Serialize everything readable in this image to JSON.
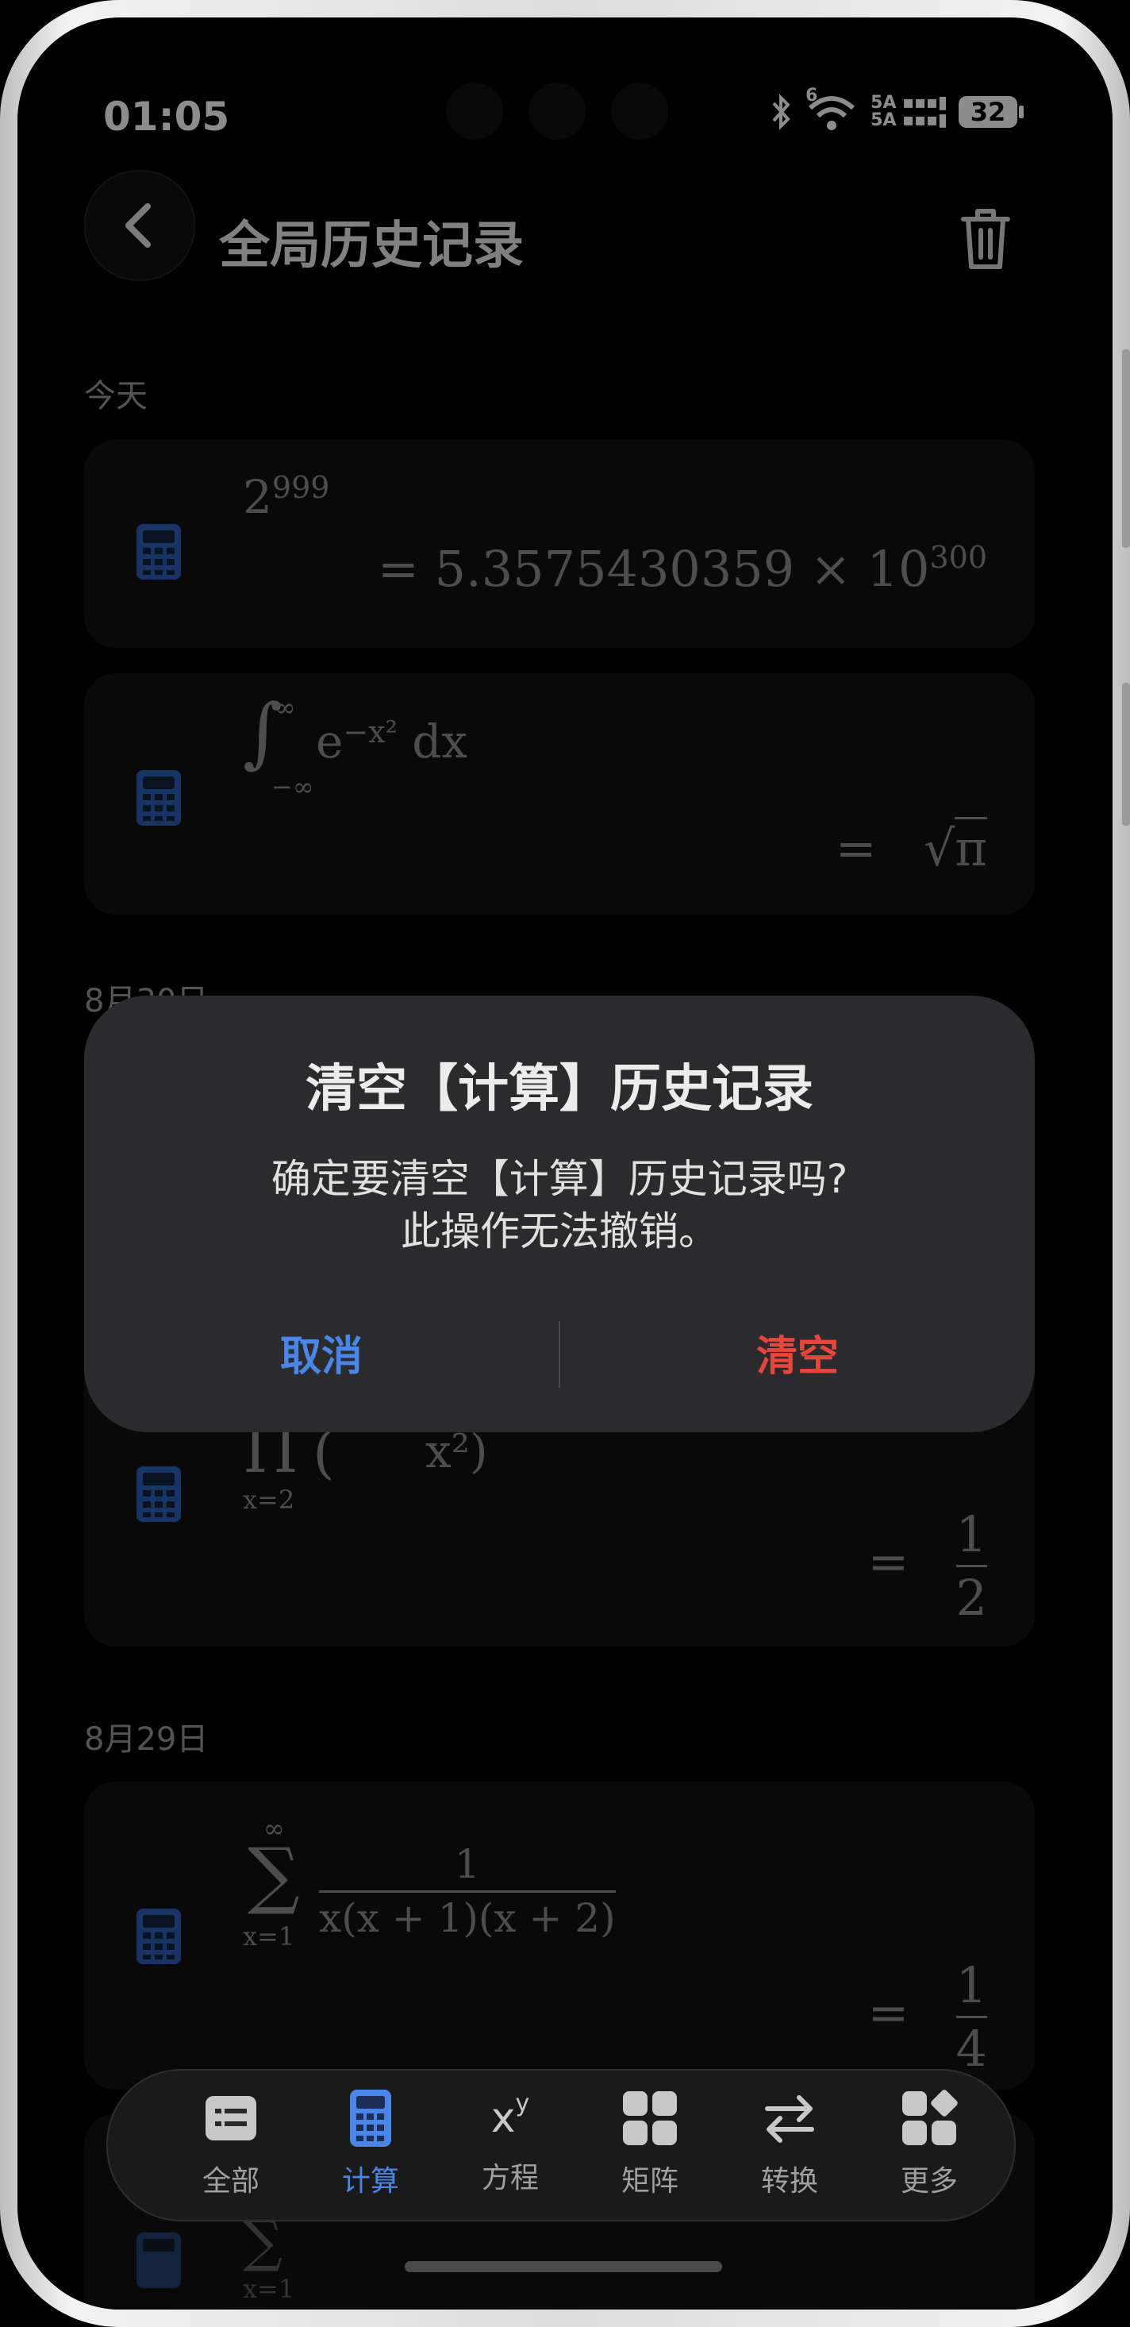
{
  "status": {
    "time": "01:05",
    "battery": "32",
    "signal_top": "5A",
    "signal_bottom": "5A",
    "wifi_badge": "6"
  },
  "header": {
    "title": "全局历史记录"
  },
  "sections": [
    {
      "label": "今天"
    },
    {
      "label": "8月30日"
    },
    {
      "label": "8月29日"
    }
  ],
  "entries": [
    {
      "expr_base": "2",
      "expr_exp": "999",
      "ans_mant": "=  5.3575430359 × 10",
      "ans_exp": "300"
    },
    {
      "expr_lower": "−∞",
      "expr_upper": "∞",
      "expr_body": "e",
      "expr_exp": "−x²",
      "expr_tail": "dx",
      "ans_eq": "=",
      "ans_val": "π"
    },
    {
      "expr_prod": "Π",
      "expr_paren": "(",
      "expr_close": "x²)",
      "expr_lower": "x=2",
      "ans_eq": "=",
      "ans_num": "1",
      "ans_den": "2"
    },
    {
      "expr_sum": "∑",
      "expr_upper": "∞",
      "expr_lower": "x=1",
      "expr_num": "1",
      "expr_den": "x(x + 1)(x + 2)",
      "ans_eq": "=",
      "ans_num": "1",
      "ans_den": "4"
    },
    {
      "expr_sum": "∑",
      "expr_lower": "x=1"
    }
  ],
  "dialog": {
    "title": "清空【计算】历史记录",
    "message_line1": "确定要清空【计算】历史记录吗?",
    "message_line2": "此操作无法撤销。",
    "cancel": "取消",
    "confirm": "清空"
  },
  "nav": [
    {
      "label": "全部",
      "icon": "list-icon"
    },
    {
      "label": "计算",
      "icon": "calculator-icon",
      "active": true
    },
    {
      "label": "方程",
      "icon": "power-icon",
      "glyph_base": "x",
      "glyph_exp": "y"
    },
    {
      "label": "矩阵",
      "icon": "grid-icon"
    },
    {
      "label": "转换",
      "icon": "swap-icon"
    },
    {
      "label": "更多",
      "icon": "more-icon"
    }
  ],
  "colors": {
    "accent_blue": "#4a86e8",
    "danger_red": "#e8453c",
    "icon_blue": "#2d5fb3"
  }
}
